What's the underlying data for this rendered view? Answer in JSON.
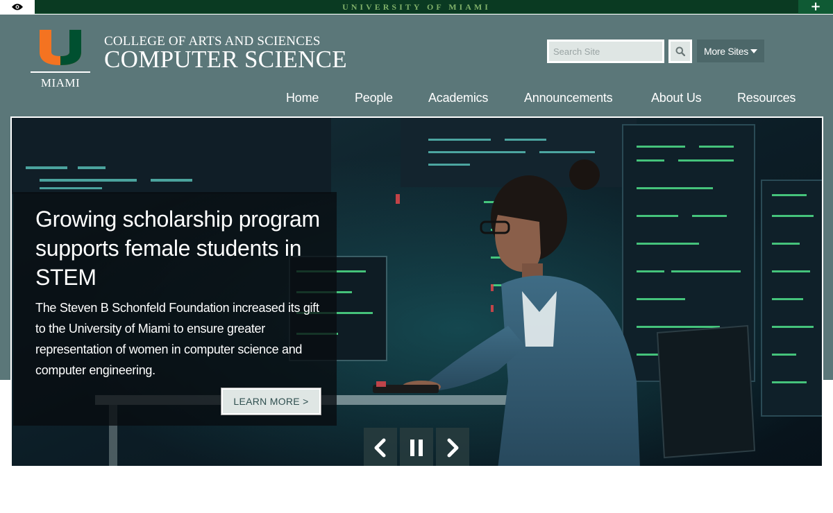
{
  "topbar": {
    "title": "UNIVERSITY OF MIAMI",
    "plus_label": "+",
    "bg_color": "#0a3a22",
    "title_color": "#7fb069"
  },
  "header": {
    "logo_text": "MIAMI",
    "college": "COLLEGE OF ARTS AND SCIENCES",
    "department": "COMPUTER SCIENCE",
    "bg_color": "#5b7779"
  },
  "search": {
    "placeholder": "Search Site",
    "value": ""
  },
  "more_sites": {
    "label": "More Sites"
  },
  "nav": {
    "items": [
      {
        "label": "Home"
      },
      {
        "label": "People"
      },
      {
        "label": "Academics"
      },
      {
        "label": "Announcements"
      },
      {
        "label": "About Us"
      },
      {
        "label": "Resources"
      }
    ]
  },
  "hero": {
    "title": "Growing scholarship program supports female students in STEM",
    "body": "The Steven B Schonfeld Foundation increased its gift to the University of Miami to ensure greater representation of women in computer science and computer engineering.",
    "button_label": "LEARN MORE >"
  },
  "icons": {
    "eye": "eye-icon",
    "search": "search-icon",
    "caret": "caret-down-icon",
    "prev": "chevron-left-icon",
    "pause": "pause-icon",
    "next": "chevron-right-icon",
    "logo": "university-u-logo-icon"
  },
  "colors": {
    "logo_orange": "#f47321",
    "logo_green": "#005030"
  }
}
